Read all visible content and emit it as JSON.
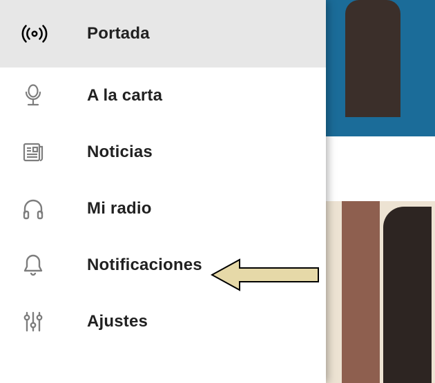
{
  "drawer": {
    "items": [
      {
        "label": "Portada",
        "icon": "broadcast-icon",
        "selected": true
      },
      {
        "label": "A la carta",
        "icon": "microphone-icon",
        "selected": false
      },
      {
        "label": "Noticias",
        "icon": "news-icon",
        "selected": false
      },
      {
        "label": "Mi radio",
        "icon": "headphones-icon",
        "selected": false
      },
      {
        "label": "Notificaciones",
        "icon": "bell-icon",
        "selected": false
      },
      {
        "label": "Ajustes",
        "icon": "sliders-icon",
        "selected": false
      }
    ]
  },
  "annotation": {
    "arrow_target_index": 4,
    "arrow_fill": "#E6D9A8",
    "arrow_stroke": "#000000"
  }
}
